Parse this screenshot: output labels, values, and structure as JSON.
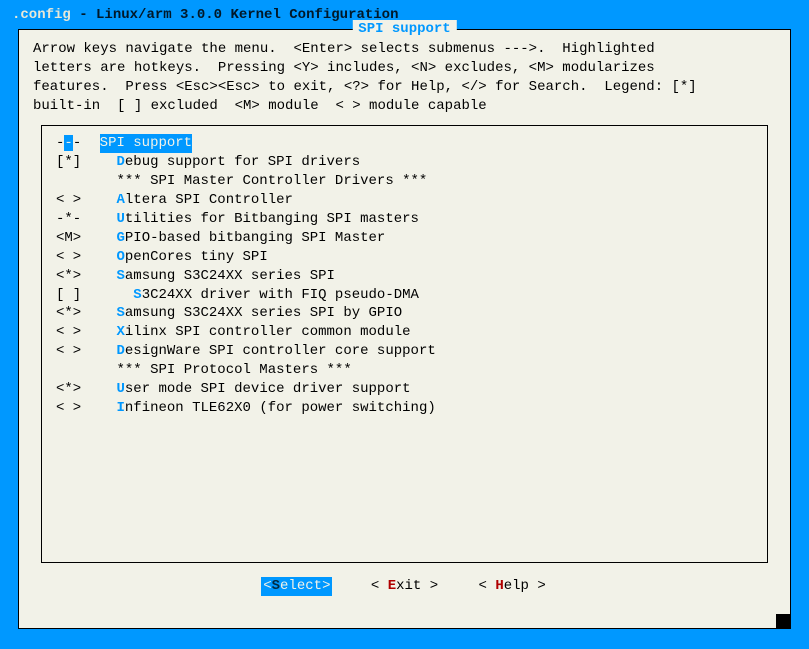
{
  "titlebar": {
    "filename": ".config",
    "sep": " - ",
    "desc": "Linux/arm 3.0.0 Kernel Configuration"
  },
  "section_title": "SPI support",
  "help_line1": "Arrow keys navigate the menu.  <Enter> selects submenus --->.  Highlighted",
  "help_line2": "letters are hotkeys.  Pressing <Y> includes, <N> excludes, <M> modularizes",
  "help_line3": "features.  Press <Esc><Esc> to exit, <?> for Help, </> for Search.  Legend: [*]",
  "help_line4": "built-in  [ ] excluded  <M> module  < > module capable",
  "menu": [
    {
      "marker": "---",
      "indent": 0,
      "hotkey": "",
      "label": "SPI support",
      "selected": true
    },
    {
      "marker": "[*]",
      "indent": 1,
      "hotkey": "D",
      "label": "ebug support for SPI drivers",
      "selected": false
    },
    {
      "marker": "   ",
      "indent": 1,
      "hotkey": "",
      "label": "*** SPI Master Controller Drivers ***",
      "selected": false
    },
    {
      "marker": "< >",
      "indent": 1,
      "hotkey": "A",
      "label": "ltera SPI Controller",
      "selected": false
    },
    {
      "marker": "-*-",
      "indent": 1,
      "hotkey": "U",
      "label": "tilities for Bitbanging SPI masters",
      "selected": false
    },
    {
      "marker": "<M>",
      "indent": 1,
      "hotkey": "G",
      "label": "PIO-based bitbanging SPI Master",
      "selected": false
    },
    {
      "marker": "< >",
      "indent": 1,
      "hotkey": "O",
      "label": "penCores tiny SPI",
      "selected": false
    },
    {
      "marker": "<*>",
      "indent": 1,
      "hotkey": "S",
      "label": "amsung S3C24XX series SPI",
      "selected": false
    },
    {
      "marker": "[ ]",
      "indent": 2,
      "hotkey": "S",
      "label": "3C24XX driver with FIQ pseudo-DMA",
      "selected": false
    },
    {
      "marker": "<*>",
      "indent": 1,
      "hotkey": "S",
      "label": "amsung S3C24XX series SPI by GPIO",
      "selected": false
    },
    {
      "marker": "< >",
      "indent": 1,
      "hotkey": "X",
      "label": "ilinx SPI controller common module",
      "selected": false
    },
    {
      "marker": "< >",
      "indent": 1,
      "hotkey": "D",
      "label": "esignWare SPI controller core support",
      "selected": false
    },
    {
      "marker": "   ",
      "indent": 1,
      "hotkey": "",
      "label": "*** SPI Protocol Masters ***",
      "selected": false
    },
    {
      "marker": "<*>",
      "indent": 1,
      "hotkey": "U",
      "label": "ser mode SPI device driver support",
      "selected": false
    },
    {
      "marker": "< >",
      "indent": 1,
      "hotkey": "I",
      "label": "nfineon TLE62X0 (for power switching)",
      "selected": false
    }
  ],
  "buttons": {
    "select": {
      "left": "<",
      "hotkey": "S",
      "rest": "elect",
      "right": ">",
      "selected": true
    },
    "exit": {
      "left": "< ",
      "hotkey": "E",
      "rest": "xit ",
      "right": ">",
      "selected": false
    },
    "help": {
      "left": "< ",
      "hotkey": "H",
      "rest": "elp ",
      "right": ">",
      "selected": false
    }
  }
}
